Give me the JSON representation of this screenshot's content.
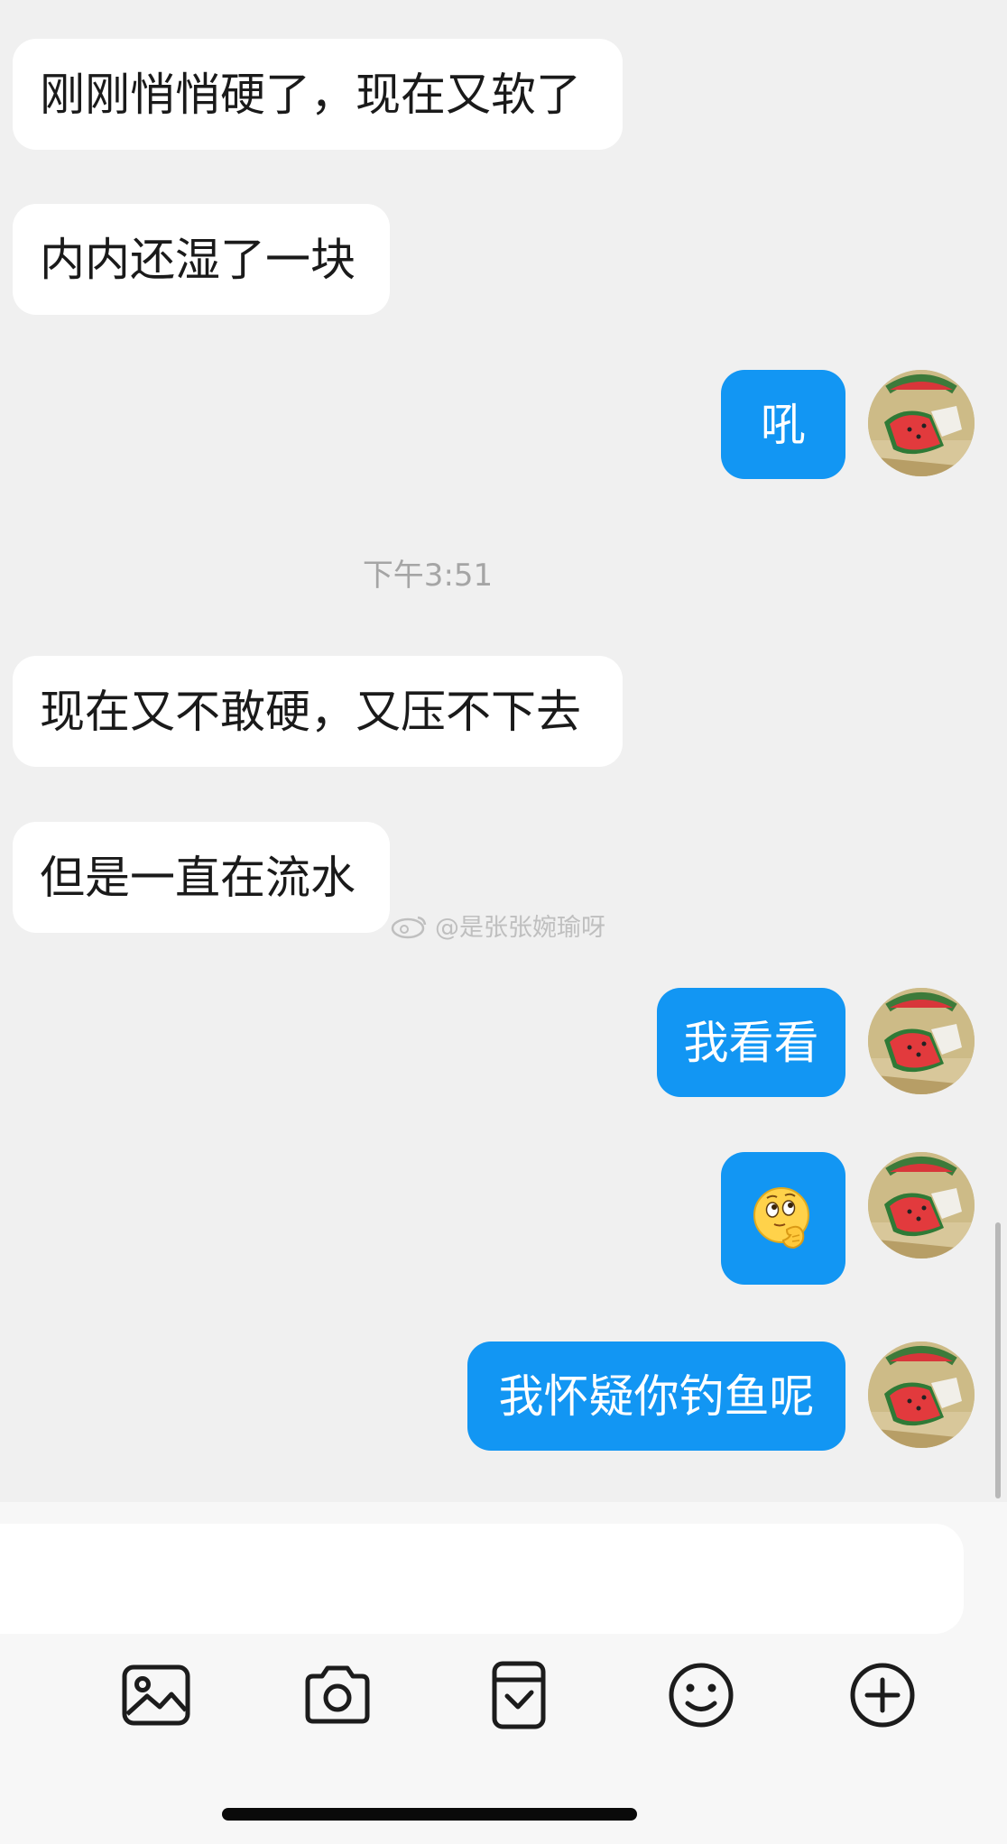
{
  "colors": {
    "accent": "#1296f3",
    "background": "#f0f0f0",
    "incoming_bubble": "#ffffff",
    "timestamp": "#a5a5a5"
  },
  "messages": [
    {
      "direction": "incoming",
      "text": "刚刚悄悄硬了，现在又软了"
    },
    {
      "direction": "incoming",
      "text": "内内还湿了一块"
    },
    {
      "direction": "outgoing",
      "text": "吼"
    },
    {
      "direction": "incoming",
      "text": "现在又不敢硬，又压不下去"
    },
    {
      "direction": "incoming",
      "text": "但是一直在流水"
    },
    {
      "direction": "outgoing",
      "text": "我看看"
    },
    {
      "direction": "outgoing",
      "sticker": "thinking-face-sticker"
    },
    {
      "direction": "outgoing",
      "text": "我怀疑你钓鱼呢"
    }
  ],
  "timestamp": "下午3:51",
  "watermark": "@是张张婉瑜呀",
  "composer": {
    "placeholder": "",
    "tools": [
      "image-icon",
      "camera-icon",
      "sticker-card-icon",
      "emoji-icon",
      "add-icon"
    ]
  }
}
